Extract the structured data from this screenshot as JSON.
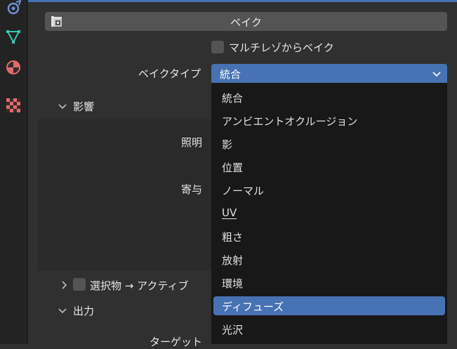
{
  "bake": {
    "button_label": "ベイク",
    "multires_label": "マルチレゾからベイク",
    "bake_type_label": "ベイクタイプ",
    "bake_type_value": "統合"
  },
  "sections": {
    "influence": "影響",
    "lighting": "照明",
    "contribution": "寄与",
    "selected_to_active": "選択物 → アクティブ",
    "output": "出力",
    "target": "ターゲット"
  },
  "dropdown": {
    "items": [
      "統合",
      "アンビエントオクルージョン",
      "影",
      "位置",
      "ノーマル",
      "UV",
      "粗さ",
      "放射",
      "環境",
      "ディフューズ",
      "光沢"
    ],
    "selected": "ディフューズ"
  },
  "colors": {
    "accent": "#4772b3",
    "panel_bg": "#303030",
    "menu_bg": "#181818"
  }
}
